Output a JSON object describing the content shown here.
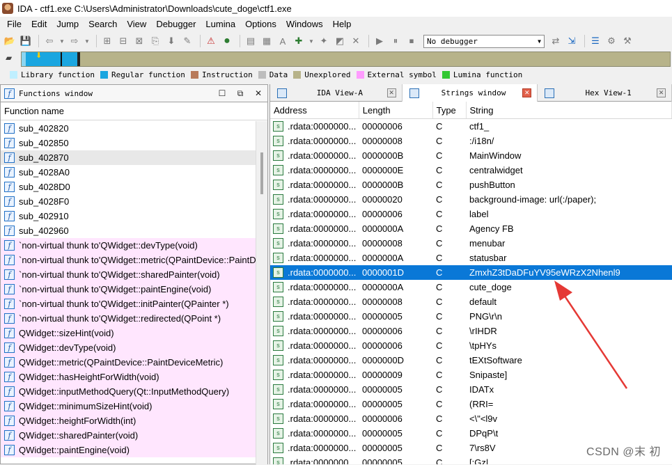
{
  "window": {
    "title": "IDA - ctf1.exe C:\\Users\\Administrator\\Downloads\\cute_doge\\ctf1.exe"
  },
  "menu": [
    "File",
    "Edit",
    "Jump",
    "Search",
    "View",
    "Debugger",
    "Lumina",
    "Options",
    "Windows",
    "Help"
  ],
  "toolbar": {
    "debugger_value": "No debugger"
  },
  "legend": [
    {
      "label": "Library function",
      "color": "#bfefff"
    },
    {
      "label": "Regular function",
      "color": "#1aa6e0"
    },
    {
      "label": "Instruction",
      "color": "#b87a5a"
    },
    {
      "label": "Data",
      "color": "#bdbdbd"
    },
    {
      "label": "Unexplored",
      "color": "#b7b38a"
    },
    {
      "label": "External symbol",
      "color": "#ff9cff"
    },
    {
      "label": "Lumina function",
      "color": "#32c832"
    }
  ],
  "functions_window": {
    "title": "Functions window",
    "column_header": "Function name",
    "items": [
      {
        "name": "sub_402820",
        "style": ""
      },
      {
        "name": "sub_402850",
        "style": ""
      },
      {
        "name": "sub_402870",
        "style": "sel"
      },
      {
        "name": "sub_4028A0",
        "style": ""
      },
      {
        "name": "sub_4028D0",
        "style": ""
      },
      {
        "name": "sub_4028F0",
        "style": ""
      },
      {
        "name": "sub_402910",
        "style": ""
      },
      {
        "name": "sub_402960",
        "style": ""
      },
      {
        "name": "`non-virtual thunk to'QWidget::devType(void)",
        "style": "pink"
      },
      {
        "name": "`non-virtual thunk to'QWidget::metric(QPaintDevice::PaintDeviceMetric)",
        "style": "pink"
      },
      {
        "name": "`non-virtual thunk to'QWidget::sharedPainter(void)",
        "style": "pink"
      },
      {
        "name": "`non-virtual thunk to'QWidget::paintEngine(void)",
        "style": "pink"
      },
      {
        "name": "`non-virtual thunk to'QWidget::initPainter(QPainter *)",
        "style": "pink"
      },
      {
        "name": "`non-virtual thunk to'QWidget::redirected(QPoint *)",
        "style": "pink"
      },
      {
        "name": "QWidget::sizeHint(void)",
        "style": "pink"
      },
      {
        "name": "QWidget::devType(void)",
        "style": "pink"
      },
      {
        "name": "QWidget::metric(QPaintDevice::PaintDeviceMetric)",
        "style": "pink"
      },
      {
        "name": "QWidget::hasHeightForWidth(void)",
        "style": "pink"
      },
      {
        "name": "QWidget::inputMethodQuery(Qt::InputMethodQuery)",
        "style": "pink"
      },
      {
        "name": "QWidget::minimumSizeHint(void)",
        "style": "pink"
      },
      {
        "name": "QWidget::heightForWidth(int)",
        "style": "pink"
      },
      {
        "name": "QWidget::sharedPainter(void)",
        "style": "pink"
      },
      {
        "name": "QWidget::paintEngine(void)",
        "style": "pink"
      }
    ]
  },
  "tabs": [
    {
      "label": "IDA View-A",
      "active": false
    },
    {
      "label": "Strings window",
      "active": true
    },
    {
      "label": "Hex View-1",
      "active": false
    }
  ],
  "strings_window": {
    "columns": [
      "Address",
      "Length",
      "Type",
      "String"
    ],
    "rows": [
      {
        "address": ".rdata:0000000...",
        "length": "00000006",
        "type": "C",
        "string": "ctf1_",
        "selected": false
      },
      {
        "address": ".rdata:0000000...",
        "length": "00000008",
        "type": "C",
        "string": ":/i18n/",
        "selected": false
      },
      {
        "address": ".rdata:0000000...",
        "length": "0000000B",
        "type": "C",
        "string": "MainWindow",
        "selected": false
      },
      {
        "address": ".rdata:0000000...",
        "length": "0000000E",
        "type": "C",
        "string": "centralwidget",
        "selected": false
      },
      {
        "address": ".rdata:0000000...",
        "length": "0000000B",
        "type": "C",
        "string": "pushButton",
        "selected": false
      },
      {
        "address": ".rdata:0000000...",
        "length": "00000020",
        "type": "C",
        "string": "background-image: url(:/paper);",
        "selected": false
      },
      {
        "address": ".rdata:0000000...",
        "length": "00000006",
        "type": "C",
        "string": "label",
        "selected": false
      },
      {
        "address": ".rdata:0000000...",
        "length": "0000000A",
        "type": "C",
        "string": "Agency FB",
        "selected": false
      },
      {
        "address": ".rdata:0000000...",
        "length": "00000008",
        "type": "C",
        "string": "menubar",
        "selected": false
      },
      {
        "address": ".rdata:0000000...",
        "length": "0000000A",
        "type": "C",
        "string": "statusbar",
        "selected": false
      },
      {
        "address": ".rdata:0000000...",
        "length": "0000001D",
        "type": "C",
        "string": "ZmxhZ3tDaDFuYV95eWRzX2Nhenl9",
        "selected": true
      },
      {
        "address": ".rdata:0000000...",
        "length": "0000000A",
        "type": "C",
        "string": "cute_doge",
        "selected": false
      },
      {
        "address": ".rdata:0000000...",
        "length": "00000008",
        "type": "C",
        "string": "default",
        "selected": false
      },
      {
        "address": ".rdata:0000000...",
        "length": "00000005",
        "type": "C",
        "string": "PNG\\r\\n",
        "selected": false
      },
      {
        "address": ".rdata:0000000...",
        "length": "00000006",
        "type": "C",
        "string": "\\rIHDR",
        "selected": false
      },
      {
        "address": ".rdata:0000000...",
        "length": "00000006",
        "type": "C",
        "string": "\\tpHYs",
        "selected": false
      },
      {
        "address": ".rdata:0000000...",
        "length": "0000000D",
        "type": "C",
        "string": "tEXtSoftware",
        "selected": false
      },
      {
        "address": ".rdata:0000000...",
        "length": "00000009",
        "type": "C",
        "string": "Snipaste]",
        "selected": false
      },
      {
        "address": ".rdata:0000000...",
        "length": "00000005",
        "type": "C",
        "string": "IDATx",
        "selected": false
      },
      {
        "address": ".rdata:0000000...",
        "length": "00000005",
        "type": "C",
        "string": "(RRI=",
        "selected": false
      },
      {
        "address": ".rdata:0000000...",
        "length": "00000006",
        "type": "C",
        "string": "<\\\"<l9v",
        "selected": false
      },
      {
        "address": ".rdata:0000000...",
        "length": "00000005",
        "type": "C",
        "string": "DPqP\\t",
        "selected": false
      },
      {
        "address": ".rdata:0000000...",
        "length": "00000005",
        "type": "C",
        "string": "7\\rs8V",
        "selected": false
      },
      {
        "address": ".rdata:0000000...",
        "length": "00000005",
        "type": "C",
        "string": "[:Gz|",
        "selected": false
      }
    ]
  },
  "watermark": "CSDN @末 初"
}
